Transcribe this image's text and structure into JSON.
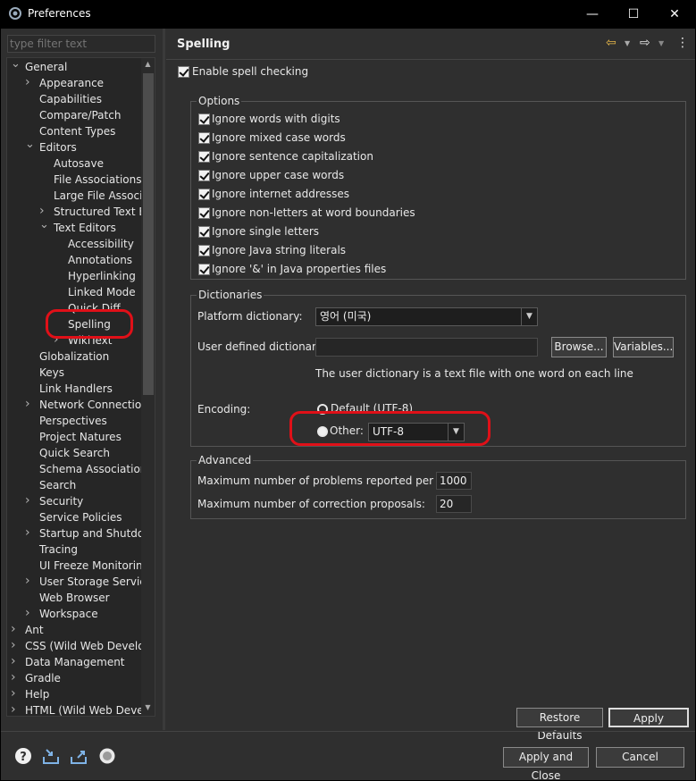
{
  "window": {
    "title": "Preferences",
    "minimize": "—",
    "maximize": "☐",
    "close": "✕"
  },
  "filter": {
    "placeholder": "type filter text"
  },
  "tree": [
    {
      "label": "General",
      "level": 0,
      "twisty": "v"
    },
    {
      "label": "Appearance",
      "level": 1,
      "twisty": ">"
    },
    {
      "label": "Capabilities",
      "level": 1,
      "twisty": ""
    },
    {
      "label": "Compare/Patch",
      "level": 1,
      "twisty": ""
    },
    {
      "label": "Content Types",
      "level": 1,
      "twisty": ""
    },
    {
      "label": "Editors",
      "level": 1,
      "twisty": "v"
    },
    {
      "label": "Autosave",
      "level": 2,
      "twisty": ""
    },
    {
      "label": "File Associations",
      "level": 2,
      "twisty": ""
    },
    {
      "label": "Large File Associations",
      "level": 2,
      "twisty": ""
    },
    {
      "label": "Structured Text Editors",
      "level": 2,
      "twisty": ">"
    },
    {
      "label": "Text Editors",
      "level": 2,
      "twisty": "v"
    },
    {
      "label": "Accessibility",
      "level": 3,
      "twisty": ""
    },
    {
      "label": "Annotations",
      "level": 3,
      "twisty": ""
    },
    {
      "label": "Hyperlinking",
      "level": 3,
      "twisty": ""
    },
    {
      "label": "Linked Mode",
      "level": 3,
      "twisty": ""
    },
    {
      "label": "Quick Diff",
      "level": 3,
      "twisty": ""
    },
    {
      "label": "Spelling",
      "level": 3,
      "twisty": "",
      "selected": true
    },
    {
      "label": "WikiText",
      "level": 3,
      "twisty": ">"
    },
    {
      "label": "Globalization",
      "level": 1,
      "twisty": ""
    },
    {
      "label": "Keys",
      "level": 1,
      "twisty": ""
    },
    {
      "label": "Link Handlers",
      "level": 1,
      "twisty": ""
    },
    {
      "label": "Network Connections",
      "level": 1,
      "twisty": ">"
    },
    {
      "label": "Perspectives",
      "level": 1,
      "twisty": ""
    },
    {
      "label": "Project Natures",
      "level": 1,
      "twisty": ""
    },
    {
      "label": "Quick Search",
      "level": 1,
      "twisty": ""
    },
    {
      "label": "Schema Associations",
      "level": 1,
      "twisty": ""
    },
    {
      "label": "Search",
      "level": 1,
      "twisty": ""
    },
    {
      "label": "Security",
      "level": 1,
      "twisty": ">"
    },
    {
      "label": "Service Policies",
      "level": 1,
      "twisty": ""
    },
    {
      "label": "Startup and Shutdown",
      "level": 1,
      "twisty": ">"
    },
    {
      "label": "Tracing",
      "level": 1,
      "twisty": ""
    },
    {
      "label": "UI Freeze Monitoring",
      "level": 1,
      "twisty": ""
    },
    {
      "label": "User Storage Service",
      "level": 1,
      "twisty": ">"
    },
    {
      "label": "Web Browser",
      "level": 1,
      "twisty": ""
    },
    {
      "label": "Workspace",
      "level": 1,
      "twisty": ">"
    },
    {
      "label": "Ant",
      "level": 0,
      "twisty": ">"
    },
    {
      "label": "CSS (Wild Web Developer)",
      "level": 0,
      "twisty": ">"
    },
    {
      "label": "Data Management",
      "level": 0,
      "twisty": ">"
    },
    {
      "label": "Gradle",
      "level": 0,
      "twisty": ">"
    },
    {
      "label": "Help",
      "level": 0,
      "twisty": ">"
    },
    {
      "label": "HTML (Wild Web Developer)",
      "level": 0,
      "twisty": ">"
    }
  ],
  "page": {
    "title": "Spelling",
    "nav": {
      "back": "⇦",
      "forward": "⇨",
      "menu": "⋮"
    },
    "enable_spell": "Enable spell checking",
    "options": {
      "title": "Options",
      "items": [
        "Ignore words with digits",
        "Ignore mixed case words",
        "Ignore sentence capitalization",
        "Ignore upper case words",
        "Ignore internet addresses",
        "Ignore non-letters at word boundaries",
        "Ignore single letters",
        "Ignore Java string literals",
        "Ignore '&' in Java properties files"
      ]
    },
    "dictionaries": {
      "title": "Dictionaries",
      "platform_label": "Platform dictionary:",
      "platform_value": "영어 (미국)",
      "user_label": "User defined dictionary:",
      "user_value": "",
      "browse": "Browse...",
      "variables": "Variables...",
      "hint": "The user dictionary is a text file with one word on each line",
      "encoding_label": "Encoding:",
      "default_option": "Default (UTF-8)",
      "other_option": "Other:",
      "other_value": "UTF-8"
    },
    "advanced": {
      "title": "Advanced",
      "max_problems_label": "Maximum number of problems reported per file:",
      "max_problems": "1000",
      "max_proposals_label": "Maximum number of correction proposals:",
      "max_proposals": "20"
    },
    "restore_defaults": "Restore Defaults",
    "apply": "Apply"
  },
  "footer": {
    "apply_close": "Apply and Close",
    "cancel": "Cancel",
    "icons": [
      "help-icon",
      "import-icon",
      "export-icon",
      "record-icon"
    ]
  },
  "colors": {
    "highlight": "#e01018",
    "background": "#2f2f2f"
  }
}
